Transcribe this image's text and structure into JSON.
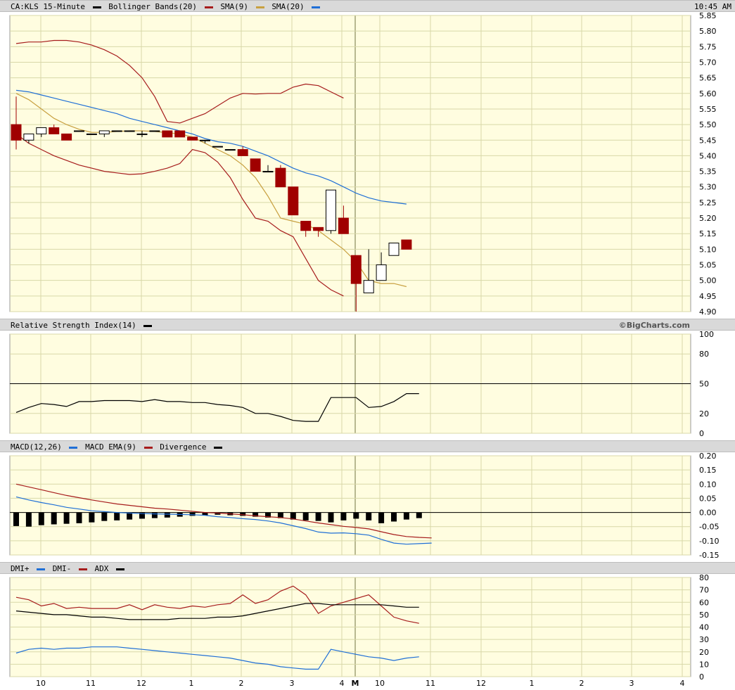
{
  "header": {
    "title": "CA:KLS 15-Minute",
    "legend": [
      {
        "label": "Bollinger Bands(20)",
        "color": "#000000"
      },
      {
        "label": "SMA(9)",
        "color": "#a61c1c"
      },
      {
        "label": "SMA(20)",
        "color": "#c8a040"
      },
      {
        "label": "",
        "color": "#1f6fd6"
      }
    ],
    "time": "10:45 AM"
  },
  "rsi_header": {
    "title": "Relative Strength Index(14)",
    "swatch": "#000000",
    "credit": "©BigCharts.com"
  },
  "macd_header": {
    "legend": [
      {
        "label": "MACD(12,26)",
        "color": "#1f6fd6"
      },
      {
        "label": "MACD EMA(9)",
        "color": "#a61c1c"
      },
      {
        "label": "Divergence",
        "color": "#000000"
      }
    ]
  },
  "dmi_header": {
    "legend": [
      {
        "label": "DMI+",
        "color": "#1f6fd6"
      },
      {
        "label": "DMI-",
        "color": "#a61c1c"
      },
      {
        "label": "ADX",
        "color": "#000000"
      }
    ]
  },
  "colors": {
    "panel_bg": "#fffde0",
    "grid": "#d8d8a8",
    "down": "#a00000",
    "up": "#ffffff",
    "bb": "#a61c1c",
    "sma9": "#c8a040",
    "sma20": "#1f6fd6",
    "macd": "#1f6fd6",
    "ema": "#a61c1c",
    "dmi_plus": "#1f6fd6",
    "dmi_minus": "#a61c1c",
    "adx": "#000000"
  },
  "chart_data": [
    {
      "type": "candlestick",
      "title": "CA:KLS 15-Minute",
      "x_ticks": [
        "10",
        "11",
        "12",
        "1",
        "2",
        "3",
        "4",
        "M",
        "10",
        "11",
        "12",
        "1",
        "2",
        "3",
        "4"
      ],
      "ylim": [
        4.9,
        5.85
      ],
      "y_ticks": [
        "5.85",
        "5.80",
        "5.75",
        "5.70",
        "5.65",
        "5.60",
        "5.55",
        "5.50",
        "5.45",
        "5.40",
        "5.35",
        "5.30",
        "5.25",
        "5.20",
        "5.15",
        "5.10",
        "5.05",
        "5.00",
        "4.95",
        "4.90"
      ],
      "candles": [
        {
          "o": 5.5,
          "h": 5.59,
          "l": 5.42,
          "c": 5.45
        },
        {
          "o": 5.45,
          "h": 5.47,
          "l": 5.44,
          "c": 5.47
        },
        {
          "o": 5.47,
          "h": 5.49,
          "l": 5.46,
          "c": 5.49
        },
        {
          "o": 5.49,
          "h": 5.5,
          "l": 5.47,
          "c": 5.47
        },
        {
          "o": 5.47,
          "h": 5.47,
          "l": 5.45,
          "c": 5.45
        },
        {
          "o": 5.48,
          "h": 5.48,
          "l": 5.48,
          "c": 5.48
        },
        {
          "o": 5.47,
          "h": 5.47,
          "l": 5.47,
          "c": 5.47
        },
        {
          "o": 5.47,
          "h": 5.48,
          "l": 5.46,
          "c": 5.48
        },
        {
          "o": 5.48,
          "h": 5.48,
          "l": 5.48,
          "c": 5.48
        },
        {
          "o": 5.48,
          "h": 5.48,
          "l": 5.48,
          "c": 5.48
        },
        {
          "o": 5.47,
          "h": 5.48,
          "l": 5.46,
          "c": 5.47
        },
        {
          "o": 5.48,
          "h": 5.48,
          "l": 5.48,
          "c": 5.48
        },
        {
          "o": 5.48,
          "h": 5.48,
          "l": 5.46,
          "c": 5.46
        },
        {
          "o": 5.48,
          "h": 5.48,
          "l": 5.46,
          "c": 5.46
        },
        {
          "o": 5.46,
          "h": 5.46,
          "l": 5.45,
          "c": 5.45
        },
        {
          "o": 5.45,
          "h": 5.45,
          "l": 5.44,
          "c": 5.45
        },
        {
          "o": 5.43,
          "h": 5.43,
          "l": 5.43,
          "c": 5.43
        },
        {
          "o": 5.42,
          "h": 5.42,
          "l": 5.42,
          "c": 5.42
        },
        {
          "o": 5.42,
          "h": 5.43,
          "l": 5.4,
          "c": 5.4
        },
        {
          "o": 5.39,
          "h": 5.39,
          "l": 5.35,
          "c": 5.35
        },
        {
          "o": 5.35,
          "h": 5.37,
          "l": 5.35,
          "c": 5.35
        },
        {
          "o": 5.36,
          "h": 5.37,
          "l": 5.3,
          "c": 5.3
        },
        {
          "o": 5.3,
          "h": 5.3,
          "l": 5.21,
          "c": 5.21
        },
        {
          "o": 5.19,
          "h": 5.19,
          "l": 5.14,
          "c": 5.16
        },
        {
          "o": 5.17,
          "h": 5.17,
          "l": 5.14,
          "c": 5.16
        },
        {
          "o": 5.16,
          "h": 5.29,
          "l": 5.15,
          "c": 5.29
        },
        {
          "o": 5.2,
          "h": 5.24,
          "l": 5.15,
          "c": 5.15
        },
        {
          "o": 5.08,
          "h": 5.08,
          "l": 4.9,
          "c": 4.99
        },
        {
          "o": 4.96,
          "h": 5.1,
          "l": 4.96,
          "c": 5.0
        },
        {
          "o": 5.0,
          "h": 5.09,
          "l": 5.0,
          "c": 5.05
        },
        {
          "o": 5.08,
          "h": 5.12,
          "l": 5.08,
          "c": 5.12
        },
        {
          "o": 5.13,
          "h": 5.13,
          "l": 5.1,
          "c": 5.1
        }
      ],
      "series": [
        {
          "name": "Bollinger Bands(20)",
          "values": [
            5.76,
            5.765,
            5.765,
            5.77,
            5.77,
            5.765,
            5.755,
            5.74,
            5.72,
            5.69,
            5.65,
            5.59,
            5.51,
            5.505,
            5.52,
            5.535,
            5.56,
            5.585,
            5.6,
            5.598,
            5.6,
            5.6,
            5.62,
            5.63,
            5.625,
            5.605,
            5.585
          ]
        },
        {
          "name": "Bollinger Bands(20)",
          "values": [
            5.47,
            5.44,
            5.42,
            5.4,
            5.385,
            5.37,
            5.36,
            5.35,
            5.345,
            5.34,
            5.342,
            5.35,
            5.36,
            5.375,
            5.42,
            5.41,
            5.38,
            5.33,
            5.26,
            5.2,
            5.19,
            5.16,
            5.14,
            5.07,
            5.0,
            4.97,
            4.95
          ]
        },
        {
          "name": "SMA(9)",
          "values": [
            5.6,
            5.58,
            5.55,
            5.52,
            5.5,
            5.485,
            5.475,
            5.475,
            5.478,
            5.48,
            5.48,
            5.478,
            5.474,
            5.47,
            5.46,
            5.44,
            5.42,
            5.4,
            5.37,
            5.33,
            5.27,
            5.2,
            5.19,
            5.18,
            5.16,
            5.13,
            5.1,
            5.06,
            5.0,
            4.99,
            4.99,
            4.98
          ]
        },
        {
          "name": "SMA(20)",
          "values": [
            5.61,
            5.605,
            5.595,
            5.585,
            5.575,
            5.565,
            5.555,
            5.545,
            5.535,
            5.52,
            5.51,
            5.5,
            5.49,
            5.48,
            5.47,
            5.455,
            5.445,
            5.44,
            5.43,
            5.415,
            5.4,
            5.38,
            5.36,
            5.345,
            5.335,
            5.32,
            5.3,
            5.28,
            5.265,
            5.255,
            5.25,
            5.245
          ]
        }
      ]
    },
    {
      "type": "line",
      "title": "Relative Strength Index(14)",
      "ylim": [
        0,
        100
      ],
      "y_ticks": [
        "100",
        "80",
        "50",
        "20",
        "0"
      ],
      "reference": 50,
      "values": [
        21,
        26,
        30,
        29,
        27,
        32,
        32,
        33,
        33,
        33,
        32,
        34,
        32,
        32,
        31,
        31,
        29,
        28,
        26,
        20,
        20,
        17,
        13,
        12,
        12,
        36,
        36,
        36,
        26,
        27,
        32,
        40,
        40
      ]
    },
    {
      "type": "bar+line",
      "title": "MACD(12,26)",
      "ylim": [
        -0.15,
        0.2
      ],
      "y_ticks": [
        "0.20",
        "0.15",
        "0.10",
        "0.05",
        "0.00",
        "-0.05",
        "-0.10",
        "-0.15"
      ],
      "divergence": [
        -0.048,
        -0.05,
        -0.045,
        -0.042,
        -0.04,
        -0.038,
        -0.035,
        -0.03,
        -0.028,
        -0.025,
        -0.022,
        -0.02,
        -0.018,
        -0.015,
        -0.012,
        -0.01,
        -0.008,
        -0.01,
        -0.012,
        -0.015,
        -0.018,
        -0.02,
        -0.025,
        -0.028,
        -0.03,
        -0.035,
        -0.028,
        -0.022,
        -0.028,
        -0.038,
        -0.032,
        -0.025,
        -0.02
      ],
      "series": [
        {
          "name": "MACD(12,26)",
          "values": [
            0.055,
            0.044,
            0.035,
            0.027,
            0.018,
            0.012,
            0.006,
            0.003,
            0.0,
            -0.002,
            -0.004,
            -0.005,
            -0.006,
            -0.007,
            -0.008,
            -0.01,
            -0.015,
            -0.018,
            -0.022,
            -0.025,
            -0.03,
            -0.037,
            -0.047,
            -0.057,
            -0.069,
            -0.073,
            -0.072,
            -0.075,
            -0.08,
            -0.095,
            -0.108,
            -0.112,
            -0.11,
            -0.108
          ]
        },
        {
          "name": "MACD EMA(9)",
          "values": [
            0.1,
            0.09,
            0.08,
            0.07,
            0.06,
            0.052,
            0.044,
            0.037,
            0.03,
            0.025,
            0.02,
            0.015,
            0.012,
            0.008,
            0.004,
            0.0,
            -0.002,
            -0.005,
            -0.008,
            -0.012,
            -0.015,
            -0.018,
            -0.023,
            -0.03,
            -0.037,
            -0.043,
            -0.049,
            -0.053,
            -0.058,
            -0.068,
            -0.078,
            -0.085,
            -0.088,
            -0.09
          ]
        }
      ]
    },
    {
      "type": "line",
      "title": "DMI",
      "ylim": [
        0,
        80
      ],
      "y_ticks": [
        "80",
        "70",
        "60",
        "50",
        "40",
        "30",
        "20",
        "10",
        "0"
      ],
      "x_ticks": [
        "10",
        "11",
        "12",
        "1",
        "2",
        "3",
        "4",
        "M",
        "10",
        "11",
        "12",
        "1",
        "2",
        "3",
        "4"
      ],
      "series": [
        {
          "name": "DMI+",
          "values": [
            19,
            22,
            23,
            22,
            23,
            23,
            24,
            24,
            24,
            23,
            22,
            21,
            20,
            19,
            18,
            17,
            16,
            15,
            13,
            11,
            10,
            8,
            7,
            6,
            6,
            22,
            20,
            18,
            16,
            15,
            13,
            15,
            16
          ]
        },
        {
          "name": "DMI-",
          "values": [
            64,
            62,
            57,
            59,
            55,
            56,
            55,
            55,
            55,
            58,
            54,
            58,
            56,
            55,
            57,
            56,
            58,
            59,
            66,
            59,
            62,
            69,
            73,
            66,
            51,
            57,
            60,
            63,
            66,
            57,
            48,
            45,
            43
          ]
        },
        {
          "name": "ADX",
          "values": [
            53,
            52,
            51,
            50,
            50,
            49,
            48,
            48,
            47,
            46,
            46,
            46,
            46,
            47,
            47,
            47,
            48,
            48,
            49,
            51,
            53,
            55,
            57,
            59,
            59,
            58,
            58,
            58,
            58,
            58,
            57,
            56,
            56
          ]
        }
      ]
    }
  ]
}
